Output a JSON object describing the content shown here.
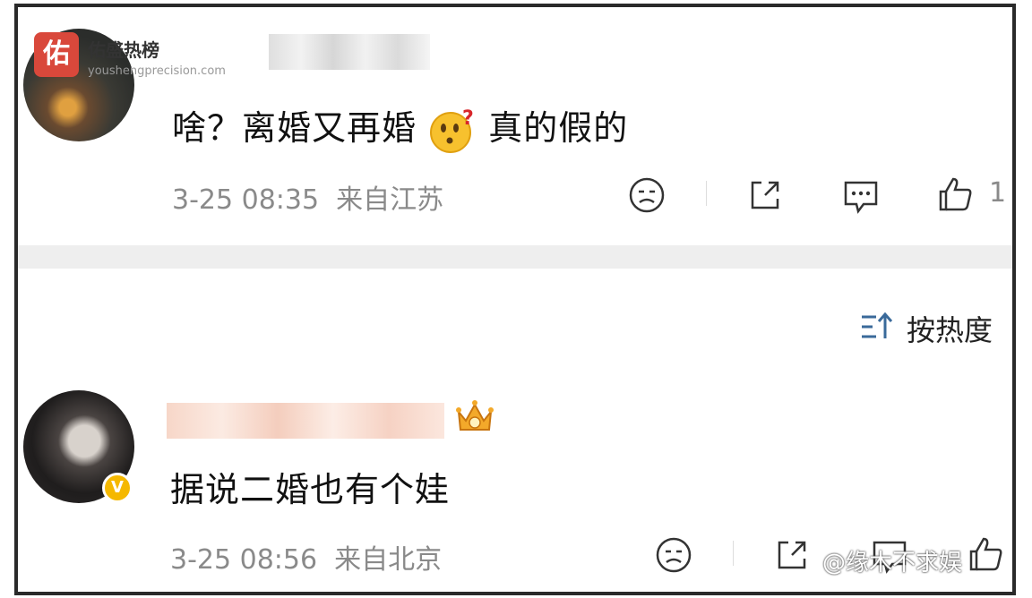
{
  "watermark": {
    "logo_char": "佑",
    "title": "佑盛热榜",
    "url": "youshengprecision.com"
  },
  "comments": [
    {
      "text_before_emoji": "啥？离婚又再婚",
      "text_after_emoji": "真的假的",
      "time": "3-25 08:35",
      "location": "来自江苏",
      "like_count": "1",
      "emoji": "thinking-face-emoji"
    },
    {
      "text": "据说二婚也有个娃",
      "time": "3-25 08:56",
      "location": "来自北京",
      "badge": "V"
    }
  ],
  "sort": {
    "label": "按热度"
  },
  "bottom_watermark": "@缘木不求娱",
  "colors": {
    "frame": "#2a2a2a",
    "meta": "#8a8a8a",
    "badge": "#f5b800",
    "divider": "#eeeeee",
    "logo": "#d9483b"
  }
}
